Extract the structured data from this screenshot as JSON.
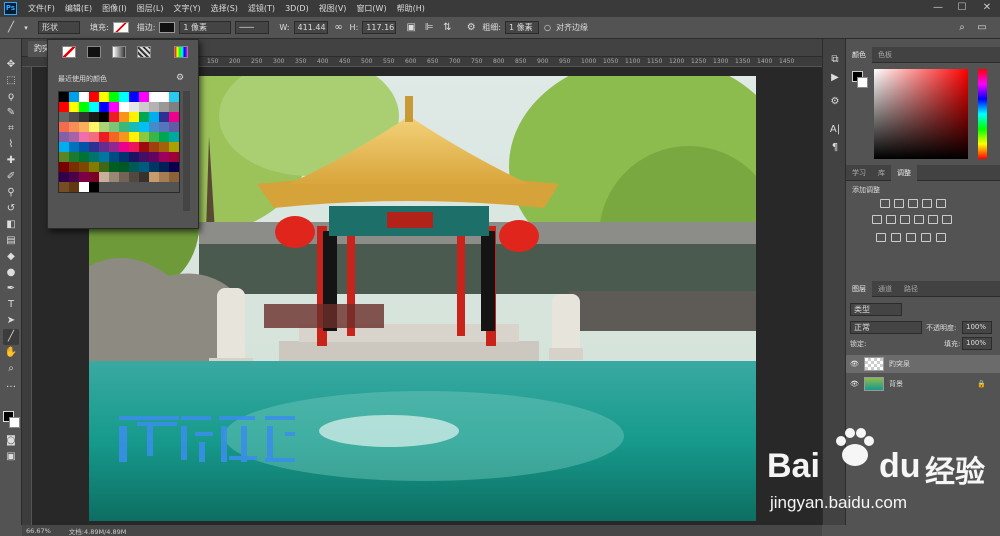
{
  "app": {
    "logo": "Ps"
  },
  "menu": [
    "文件(F)",
    "编辑(E)",
    "图像(I)",
    "图层(L)",
    "文字(Y)",
    "选择(S)",
    "滤镜(T)",
    "3D(D)",
    "视图(V)",
    "窗口(W)",
    "帮助(H)"
  ],
  "window_controls": {
    "minimize": "—",
    "maximize": "☐",
    "close": "✕"
  },
  "options": {
    "mode": "形状",
    "fill_label": "填充:",
    "stroke_label": "描边:",
    "stroke_width": "1 像素",
    "w_label": "W:",
    "w_value": "411.44",
    "h_label": "H:",
    "h_value": "117.16",
    "weight_label": "粗细:",
    "weight_value": "1 像素",
    "align_edges": "对齐边缘"
  },
  "document": {
    "tab": "趵突泉",
    "zoom": "66.67%",
    "doc_info": "文档:4.89M/4.89M"
  },
  "ruler_ticks": [
    "150",
    "200",
    "250",
    "300",
    "350",
    "400",
    "450",
    "500",
    "550",
    "600",
    "650",
    "700",
    "750",
    "800",
    "850",
    "900",
    "950",
    "1000",
    "1050",
    "1100",
    "1150",
    "1200",
    "1250",
    "1300",
    "1350",
    "1400",
    "1450"
  ],
  "swatch_popup": {
    "title": "最近使用的颜色",
    "recent": [
      "#000000",
      "#00a0e9",
      "#ffffff",
      "#ff0000",
      "#ffff00",
      "#00ff00",
      "#00ffff",
      "#0000ff",
      "#ff00ff",
      "#ffffff",
      "#ffffff",
      "#2bc8f0"
    ],
    "grid": [
      "#ff0000",
      "#ffff00",
      "#00ff00",
      "#00ffff",
      "#0000ff",
      "#ff00ff",
      "#ffffff",
      "#e6e6e6",
      "#cccccc",
      "#b3b3b3",
      "#999999",
      "#808080",
      "#666666",
      "#4d4d4d",
      "#333333",
      "#1a1a1a",
      "#000000",
      "#ed1c24",
      "#f7941d",
      "#fff200",
      "#00a651",
      "#00aeef",
      "#2e3192",
      "#ec008c",
      "#f26c4f",
      "#f68e56",
      "#fbaf5d",
      "#fff568",
      "#acd373",
      "#7cc576",
      "#3bb878",
      "#1abbb4",
      "#00bff3",
      "#438cca",
      "#5674b9",
      "#605ca8",
      "#855fa8",
      "#a763a8",
      "#f06eaa",
      "#f26d7d",
      "#ed1c24",
      "#f26522",
      "#f7941d",
      "#fff200",
      "#8dc63f",
      "#39b54a",
      "#00a651",
      "#00a99d",
      "#00aeef",
      "#0072bc",
      "#0054a6",
      "#2e3192",
      "#662d91",
      "#92278f",
      "#ec008c",
      "#ed145b",
      "#9e0b0f",
      "#a0410d",
      "#a36209",
      "#aba000",
      "#598527",
      "#1a7b30",
      "#007236",
      "#00746b",
      "#0076a3",
      "#004b80",
      "#003471",
      "#1b1464",
      "#440e62",
      "#630460",
      "#9e005d",
      "#9e0039",
      "#790000",
      "#7b2e00",
      "#7d4900",
      "#827b00",
      "#406618",
      "#005e20",
      "#005826",
      "#005952",
      "#005b7f",
      "#003663",
      "#002157",
      "#0d004c",
      "#32004b",
      "#4b0049",
      "#7b0046",
      "#7a0026",
      "#c7b299",
      "#998675",
      "#736357",
      "#534741",
      "#37302d",
      "#c69c6d",
      "#a67c52",
      "#8c6239",
      "#754c24",
      "#603913",
      "#ffffff",
      "#000000"
    ]
  },
  "panels": {
    "color_tabs": [
      "颜色",
      "色板"
    ],
    "adjust_tabs": [
      "学习",
      "库",
      "调整"
    ],
    "add_adjustment": "添加调整",
    "layers_tabs": [
      "图层",
      "通道",
      "路径"
    ],
    "kind": "类型",
    "blend_mode": "正常",
    "opacity_label": "不透明度:",
    "opacity_value": "100%",
    "lock_label": "锁定:",
    "fill_label": "填充:",
    "fill_value": "100%",
    "layers": [
      {
        "name": "趵突泉"
      },
      {
        "name": "背景"
      }
    ]
  },
  "watermark": {
    "brand_a": "Bai",
    "brand_b": "du",
    "cn": "经验",
    "url": "jingyan.baidu.com"
  },
  "colors": {
    "accent": "#31a8ff",
    "bg": "#535353",
    "dark": "#3a3a3a"
  }
}
